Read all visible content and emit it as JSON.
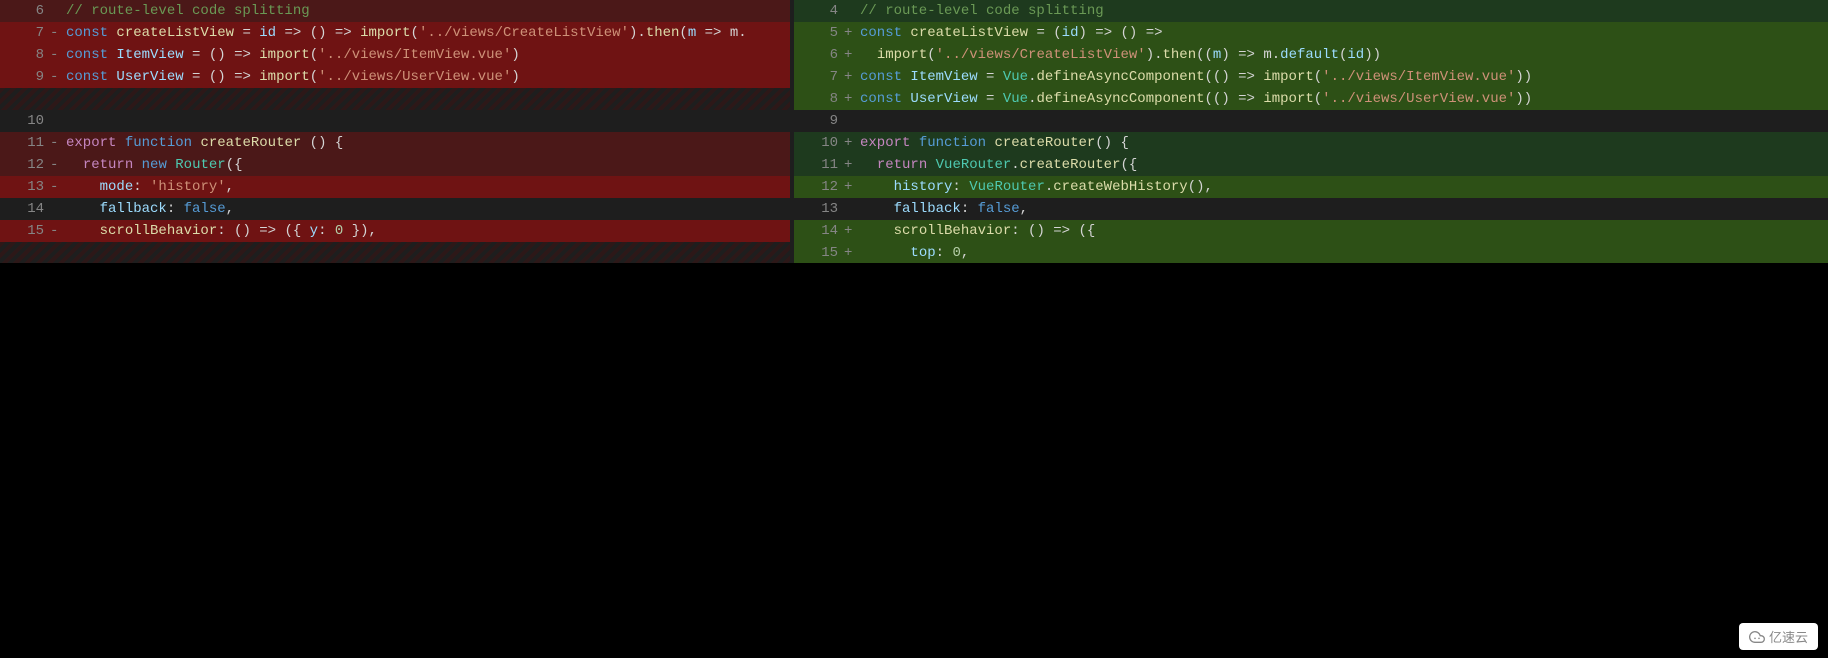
{
  "left": {
    "lines": [
      {
        "num": "6",
        "marker": "",
        "cls": "bg-deleted",
        "tokens": [
          [
            "comment",
            "// route-level code splitting"
          ]
        ]
      },
      {
        "num": "7",
        "marker": "-",
        "cls": "bg-deleted-strong",
        "tokens": [
          [
            "kw2",
            "const"
          ],
          [
            "punct",
            " "
          ],
          [
            "fn",
            "createListView"
          ],
          [
            "punct",
            " "
          ],
          [
            "op",
            "="
          ],
          [
            "punct",
            " "
          ],
          [
            "param",
            "id"
          ],
          [
            "punct",
            " "
          ],
          [
            "op",
            "=>"
          ],
          [
            "punct",
            " () "
          ],
          [
            "op",
            "=>"
          ],
          [
            "punct",
            " "
          ],
          [
            "fn",
            "import"
          ],
          [
            "punct",
            "("
          ],
          [
            "str",
            "'../views/CreateListView'"
          ],
          [
            "punct",
            ")."
          ],
          [
            "fn",
            "then"
          ],
          [
            "punct",
            "("
          ],
          [
            "param",
            "m"
          ],
          [
            "punct",
            " "
          ],
          [
            "op",
            "=>"
          ],
          [
            "punct",
            " m."
          ]
        ]
      },
      {
        "num": "8",
        "marker": "-",
        "cls": "bg-deleted-strong",
        "tokens": [
          [
            "kw2",
            "const"
          ],
          [
            "punct",
            " "
          ],
          [
            "var",
            "ItemView"
          ],
          [
            "punct",
            " "
          ],
          [
            "op",
            "="
          ],
          [
            "punct",
            " () "
          ],
          [
            "op",
            "=>"
          ],
          [
            "punct",
            " "
          ],
          [
            "fn",
            "import"
          ],
          [
            "punct",
            "("
          ],
          [
            "str",
            "'../views/ItemView.vue'"
          ],
          [
            "punct",
            ")"
          ]
        ]
      },
      {
        "num": "9",
        "marker": "-",
        "cls": "bg-deleted-strong",
        "tokens": [
          [
            "kw2",
            "const"
          ],
          [
            "punct",
            " "
          ],
          [
            "var",
            "UserView"
          ],
          [
            "punct",
            " "
          ],
          [
            "op",
            "="
          ],
          [
            "punct",
            " () "
          ],
          [
            "op",
            "=>"
          ],
          [
            "punct",
            " "
          ],
          [
            "fn",
            "import"
          ],
          [
            "punct",
            "("
          ],
          [
            "str",
            "'../views/UserView.vue'"
          ],
          [
            "punct",
            ")"
          ]
        ]
      },
      {
        "num": "",
        "marker": "",
        "cls": "bg-hatch-red",
        "tokens": []
      },
      {
        "num": "10",
        "marker": "",
        "cls": "bg-neutral",
        "tokens": []
      },
      {
        "num": "11",
        "marker": "-",
        "cls": "bg-deleted",
        "tokens": [
          [
            "kw",
            "export"
          ],
          [
            "punct",
            " "
          ],
          [
            "kw2",
            "function"
          ],
          [
            "punct",
            " "
          ],
          [
            "fn",
            "createRouter"
          ],
          [
            "punct",
            " () {"
          ]
        ]
      },
      {
        "num": "12",
        "marker": "-",
        "cls": "bg-deleted",
        "tokens": [
          [
            "punct",
            "  "
          ],
          [
            "kw",
            "return"
          ],
          [
            "punct",
            " "
          ],
          [
            "kw2",
            "new"
          ],
          [
            "punct",
            " "
          ],
          [
            "type",
            "Router"
          ],
          [
            "punct",
            "({"
          ]
        ]
      },
      {
        "num": "13",
        "marker": "-",
        "cls": "bg-deleted-strong",
        "tokens": [
          [
            "punct",
            "    "
          ],
          [
            "var",
            "mode"
          ],
          [
            "punct",
            ": "
          ],
          [
            "str",
            "'history'"
          ],
          [
            "punct",
            ","
          ]
        ]
      },
      {
        "num": "14",
        "marker": "",
        "cls": "bg-neutral",
        "tokens": [
          [
            "punct",
            "    "
          ],
          [
            "var",
            "fallback"
          ],
          [
            "punct",
            ": "
          ],
          [
            "const",
            "false"
          ],
          [
            "punct",
            ","
          ]
        ]
      },
      {
        "num": "15",
        "marker": "-",
        "cls": "bg-deleted-strong",
        "tokens": [
          [
            "punct",
            "    "
          ],
          [
            "fn",
            "scrollBehavior"
          ],
          [
            "punct",
            ": () "
          ],
          [
            "op",
            "=>"
          ],
          [
            "punct",
            " ({ "
          ],
          [
            "var",
            "y"
          ],
          [
            "punct",
            ": "
          ],
          [
            "num",
            "0"
          ],
          [
            "punct",
            " }),"
          ]
        ]
      },
      {
        "num": "",
        "marker": "",
        "cls": "bg-hatch-red",
        "tokens": []
      }
    ]
  },
  "right": {
    "lines": [
      {
        "num": "4",
        "marker": "",
        "cls": "bg-added",
        "tokens": [
          [
            "comment",
            "// route-level code splitting"
          ]
        ]
      },
      {
        "num": "5",
        "marker": "+",
        "cls": "bg-added-strong",
        "tokens": [
          [
            "kw2",
            "const"
          ],
          [
            "punct",
            " "
          ],
          [
            "fn",
            "createListView"
          ],
          [
            "punct",
            " "
          ],
          [
            "op",
            "="
          ],
          [
            "punct",
            " ("
          ],
          [
            "param",
            "id"
          ],
          [
            "punct",
            ") "
          ],
          [
            "op",
            "=>"
          ],
          [
            "punct",
            " () "
          ],
          [
            "op",
            "=>"
          ]
        ]
      },
      {
        "num": "6",
        "marker": "+",
        "cls": "bg-added-strong",
        "tokens": [
          [
            "punct",
            "  "
          ],
          [
            "fn",
            "import"
          ],
          [
            "punct",
            "("
          ],
          [
            "str",
            "'../views/CreateListView'"
          ],
          [
            "punct",
            ")."
          ],
          [
            "fn",
            "then"
          ],
          [
            "punct",
            "(("
          ],
          [
            "param",
            "m"
          ],
          [
            "punct",
            ") "
          ],
          [
            "op",
            "=>"
          ],
          [
            "punct",
            " m."
          ],
          [
            "var",
            "default"
          ],
          [
            "punct",
            "("
          ],
          [
            "var",
            "id"
          ],
          [
            "punct",
            "))"
          ]
        ]
      },
      {
        "num": "7",
        "marker": "+",
        "cls": "bg-added-strong",
        "tokens": [
          [
            "kw2",
            "const"
          ],
          [
            "punct",
            " "
          ],
          [
            "var",
            "ItemView"
          ],
          [
            "punct",
            " "
          ],
          [
            "op",
            "="
          ],
          [
            "punct",
            " "
          ],
          [
            "type",
            "Vue"
          ],
          [
            "punct",
            "."
          ],
          [
            "fn",
            "defineAsyncComponent"
          ],
          [
            "punct",
            "(() "
          ],
          [
            "op",
            "=>"
          ],
          [
            "punct",
            " "
          ],
          [
            "fn",
            "import"
          ],
          [
            "punct",
            "("
          ],
          [
            "str",
            "'../views/ItemView.vue'"
          ],
          [
            "punct",
            "))"
          ]
        ]
      },
      {
        "num": "8",
        "marker": "+",
        "cls": "bg-added-strong",
        "tokens": [
          [
            "kw2",
            "const"
          ],
          [
            "punct",
            " "
          ],
          [
            "var",
            "UserView"
          ],
          [
            "punct",
            " "
          ],
          [
            "op",
            "="
          ],
          [
            "punct",
            " "
          ],
          [
            "type",
            "Vue"
          ],
          [
            "punct",
            "."
          ],
          [
            "fn",
            "defineAsyncComponent"
          ],
          [
            "punct",
            "(() "
          ],
          [
            "op",
            "=>"
          ],
          [
            "punct",
            " "
          ],
          [
            "fn",
            "import"
          ],
          [
            "punct",
            "("
          ],
          [
            "str",
            "'../views/UserView.vue'"
          ],
          [
            "punct",
            "))"
          ]
        ]
      },
      {
        "num": "9",
        "marker": "",
        "cls": "bg-neutral",
        "tokens": []
      },
      {
        "num": "10",
        "marker": "+",
        "cls": "bg-added",
        "tokens": [
          [
            "kw",
            "export"
          ],
          [
            "punct",
            " "
          ],
          [
            "kw2",
            "function"
          ],
          [
            "punct",
            " "
          ],
          [
            "fn",
            "createRouter"
          ],
          [
            "punct",
            "() {"
          ]
        ]
      },
      {
        "num": "11",
        "marker": "+",
        "cls": "bg-added",
        "tokens": [
          [
            "punct",
            "  "
          ],
          [
            "kw",
            "return"
          ],
          [
            "punct",
            " "
          ],
          [
            "type",
            "VueRouter"
          ],
          [
            "punct",
            "."
          ],
          [
            "fn",
            "createRouter"
          ],
          [
            "punct",
            "({"
          ]
        ]
      },
      {
        "num": "12",
        "marker": "+",
        "cls": "bg-added-strong",
        "tokens": [
          [
            "punct",
            "    "
          ],
          [
            "var",
            "history"
          ],
          [
            "punct",
            ": "
          ],
          [
            "type",
            "VueRouter"
          ],
          [
            "punct",
            "."
          ],
          [
            "fn",
            "createWebHistory"
          ],
          [
            "punct",
            "(),"
          ]
        ]
      },
      {
        "num": "13",
        "marker": "",
        "cls": "bg-neutral",
        "tokens": [
          [
            "punct",
            "    "
          ],
          [
            "var",
            "fallback"
          ],
          [
            "punct",
            ": "
          ],
          [
            "const",
            "false"
          ],
          [
            "punct",
            ","
          ]
        ]
      },
      {
        "num": "14",
        "marker": "+",
        "cls": "bg-added-strong",
        "tokens": [
          [
            "punct",
            "    "
          ],
          [
            "fn",
            "scrollBehavior"
          ],
          [
            "punct",
            ": () "
          ],
          [
            "op",
            "=>"
          ],
          [
            "punct",
            " ({"
          ]
        ]
      },
      {
        "num": "15",
        "marker": "+",
        "cls": "bg-added-strong",
        "tokens": [
          [
            "punct",
            "      "
          ],
          [
            "var",
            "top"
          ],
          [
            "punct",
            ": "
          ],
          [
            "num",
            "0"
          ],
          [
            "punct",
            ","
          ]
        ]
      }
    ]
  },
  "watermark": {
    "text": "亿速云"
  }
}
